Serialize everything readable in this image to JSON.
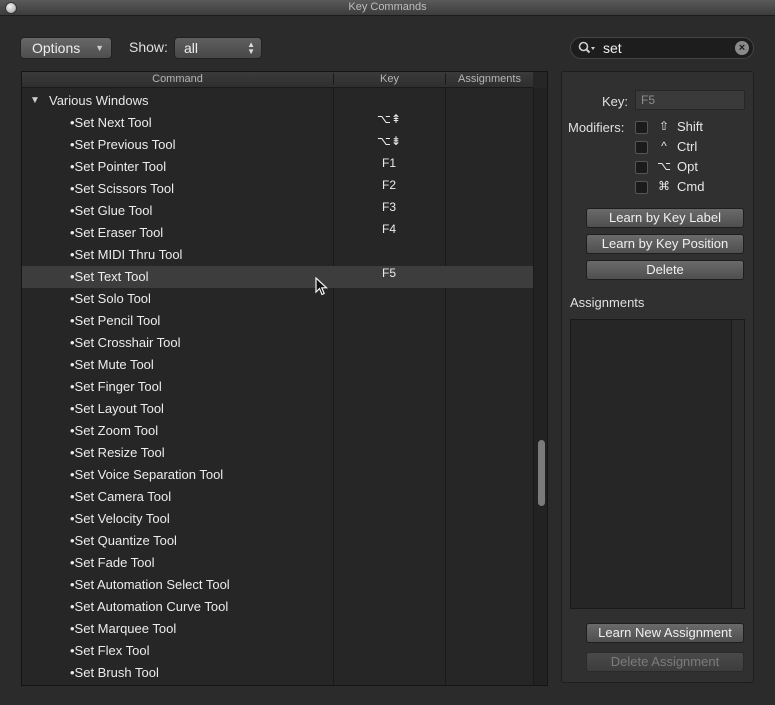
{
  "window": {
    "title": "Key Commands"
  },
  "toolbar": {
    "options_label": "Options",
    "show_label": "Show:",
    "show_value": "all",
    "search_value": "set"
  },
  "columns": {
    "command": "Command",
    "key": "Key",
    "assignments": "Assignments"
  },
  "group": {
    "name": "Various Windows"
  },
  "rows": [
    {
      "command": "•Set Next Tool",
      "key": "⌥⇞"
    },
    {
      "command": "•Set Previous Tool",
      "key": "⌥⇟"
    },
    {
      "command": "•Set Pointer Tool",
      "key": "F1"
    },
    {
      "command": "•Set Scissors Tool",
      "key": "F2"
    },
    {
      "command": "•Set Glue Tool",
      "key": "F3"
    },
    {
      "command": "•Set Eraser Tool",
      "key": "F4"
    },
    {
      "command": "•Set MIDI Thru Tool",
      "key": ""
    },
    {
      "command": "•Set Text Tool",
      "key": "F5"
    },
    {
      "command": "•Set Solo Tool",
      "key": ""
    },
    {
      "command": "•Set Pencil Tool",
      "key": ""
    },
    {
      "command": "•Set Crosshair Tool",
      "key": ""
    },
    {
      "command": "•Set Mute Tool",
      "key": ""
    },
    {
      "command": "•Set Finger Tool",
      "key": ""
    },
    {
      "command": "•Set Layout Tool",
      "key": ""
    },
    {
      "command": "•Set Zoom Tool",
      "key": ""
    },
    {
      "command": "•Set Resize Tool",
      "key": ""
    },
    {
      "command": "•Set Voice Separation Tool",
      "key": ""
    },
    {
      "command": "•Set Camera Tool",
      "key": ""
    },
    {
      "command": "•Set Velocity Tool",
      "key": ""
    },
    {
      "command": "•Set Quantize Tool",
      "key": ""
    },
    {
      "command": "•Set Fade Tool",
      "key": ""
    },
    {
      "command": "•Set Automation Select Tool",
      "key": ""
    },
    {
      "command": "•Set Automation Curve Tool",
      "key": ""
    },
    {
      "command": "•Set Marquee Tool",
      "key": ""
    },
    {
      "command": "•Set Flex Tool",
      "key": ""
    },
    {
      "command": "•Set Brush Tool",
      "key": ""
    }
  ],
  "selected_row": "•Set Text Tool",
  "side": {
    "key_label": "Key:",
    "key_value": "F5",
    "modifiers_label": "Modifiers:",
    "modifiers": [
      {
        "symbol": "⇧",
        "label": "Shift",
        "checked": false
      },
      {
        "symbol": "^",
        "label": "Ctrl",
        "checked": false
      },
      {
        "symbol": "⌥",
        "label": "Opt",
        "checked": false
      },
      {
        "symbol": "⌘",
        "label": "Cmd",
        "checked": false
      }
    ],
    "learn_label_btn": "Learn by Key Label",
    "learn_position_btn": "Learn by Key Position",
    "delete_btn": "Delete",
    "assignments_title": "Assignments",
    "learn_new_btn": "Learn New Assignment",
    "delete_assignment_btn": "Delete Assignment"
  },
  "icons": {
    "close": "close-icon",
    "search": "search-icon",
    "clear": "clear-search-icon",
    "disclosure": "disclosure-triangle-icon"
  }
}
